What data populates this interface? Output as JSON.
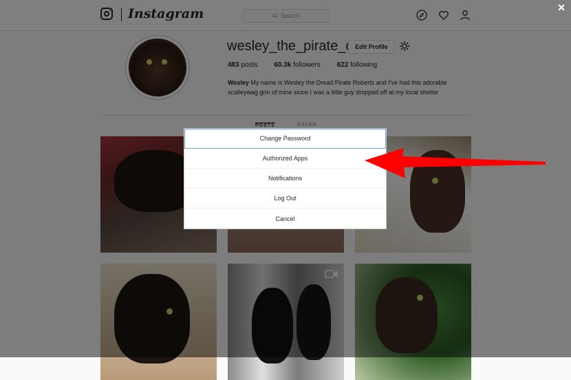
{
  "header": {
    "app_name": "Instagram",
    "search_placeholder": "Search",
    "icons": [
      "instagram-camera-icon",
      "explore-compass-icon",
      "heart-icon",
      "profile-icon"
    ],
    "close_icon": "close-icon",
    "close_label": "×"
  },
  "profile": {
    "username": "wesley_the_pirate_cat",
    "edit_button_label": "Edit Profile",
    "settings_icon": "gear-icon",
    "stats": {
      "posts_count": "483",
      "posts_label": "posts",
      "followers_count": "60.3k",
      "followers_label": "followers",
      "following_count": "622",
      "following_label": "following"
    },
    "bio_name": "Wesley",
    "bio_text": "My name is Wesley the Dread Pirate Roberts and I've had this adorable scalleywag grin of mine since I was a little guy dropped off at my local shelter"
  },
  "tabs": [
    {
      "label": "POSTS",
      "active": true
    },
    {
      "label": "SAVED",
      "active": false
    }
  ],
  "modal": {
    "items": [
      {
        "label": "Change Password"
      },
      {
        "label": "Authorized Apps"
      },
      {
        "label": "Notifications"
      },
      {
        "label": "Log Out"
      },
      {
        "label": "Cancel"
      }
    ]
  },
  "annotation": {
    "arrow_color": "#ff0000"
  },
  "colors": {
    "background": "#fafafa",
    "border": "#dbdbdb",
    "text": "#262626"
  }
}
